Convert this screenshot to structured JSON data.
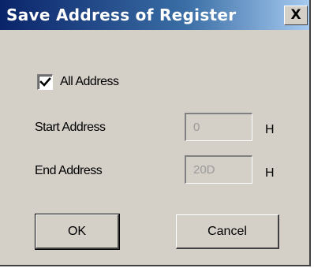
{
  "window": {
    "title": "Save Address of Register",
    "close_glyph": "X"
  },
  "all_address": {
    "label": "All Address",
    "checked": true
  },
  "start_address": {
    "label": "Start Address",
    "value": "0",
    "unit": "H"
  },
  "end_address": {
    "label": "End Address",
    "value": "20D",
    "unit": "H"
  },
  "buttons": {
    "ok_label": "OK",
    "cancel_label": "Cancel"
  },
  "colors": {
    "title_bar_start": "#0a246a",
    "title_bar_end": "#a6caf0",
    "dialog_face": "#d4d0c8"
  }
}
